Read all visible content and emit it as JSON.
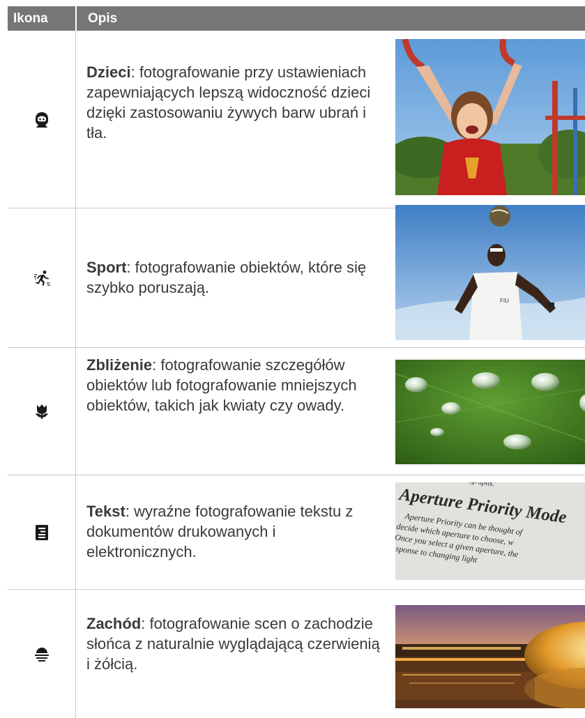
{
  "header": {
    "icon_col": "Ikona",
    "desc_col": "Opis"
  },
  "rows": [
    {
      "icon": "child-face-icon",
      "term": "Dzieci",
      "text": ": fotografowanie przy ustawieniach zapewniających lepszą widoczność dzieci dzięki zastosowaniu żywych barw ubrań i tła.",
      "photo": "child-on-playground-photo"
    },
    {
      "icon": "running-person-icon",
      "term": "Sport",
      "text": ": fotografowanie obiektów, które się szybko poruszają.",
      "photo": "soccer-player-photo"
    },
    {
      "icon": "tulip-flower-icon",
      "term": "Zbliżenie",
      "text": ": fotografowanie szczegółów obiektów lub fotografowanie mniejszych obiektów, takich jak kwiaty czy owady.",
      "photo": "water-droplets-on-leaf-photo"
    },
    {
      "icon": "document-text-icon",
      "term": "Tekst",
      "text": ": wyraźne fotografowanie tekstu z dokumentów drukowanych i elektronicznych.",
      "photo": "printed-book-page-photo",
      "photo_text": {
        "line0": "at your photographs.",
        "title": "Aperture Priority Mode",
        "line1": "Aperture Priority can be thought of",
        "line2": "decide which aperture to choose, w",
        "line3": "Once you select a given aperture, the",
        "line4": "response to changing light"
      }
    },
    {
      "icon": "sunset-icon",
      "term": "Zachód",
      "text": ": fotografowanie scen o zachodzie słońca z naturalnie wyglądającą czerwienią i żółcią.",
      "photo": "sunset-building-reflection-photo"
    }
  ]
}
